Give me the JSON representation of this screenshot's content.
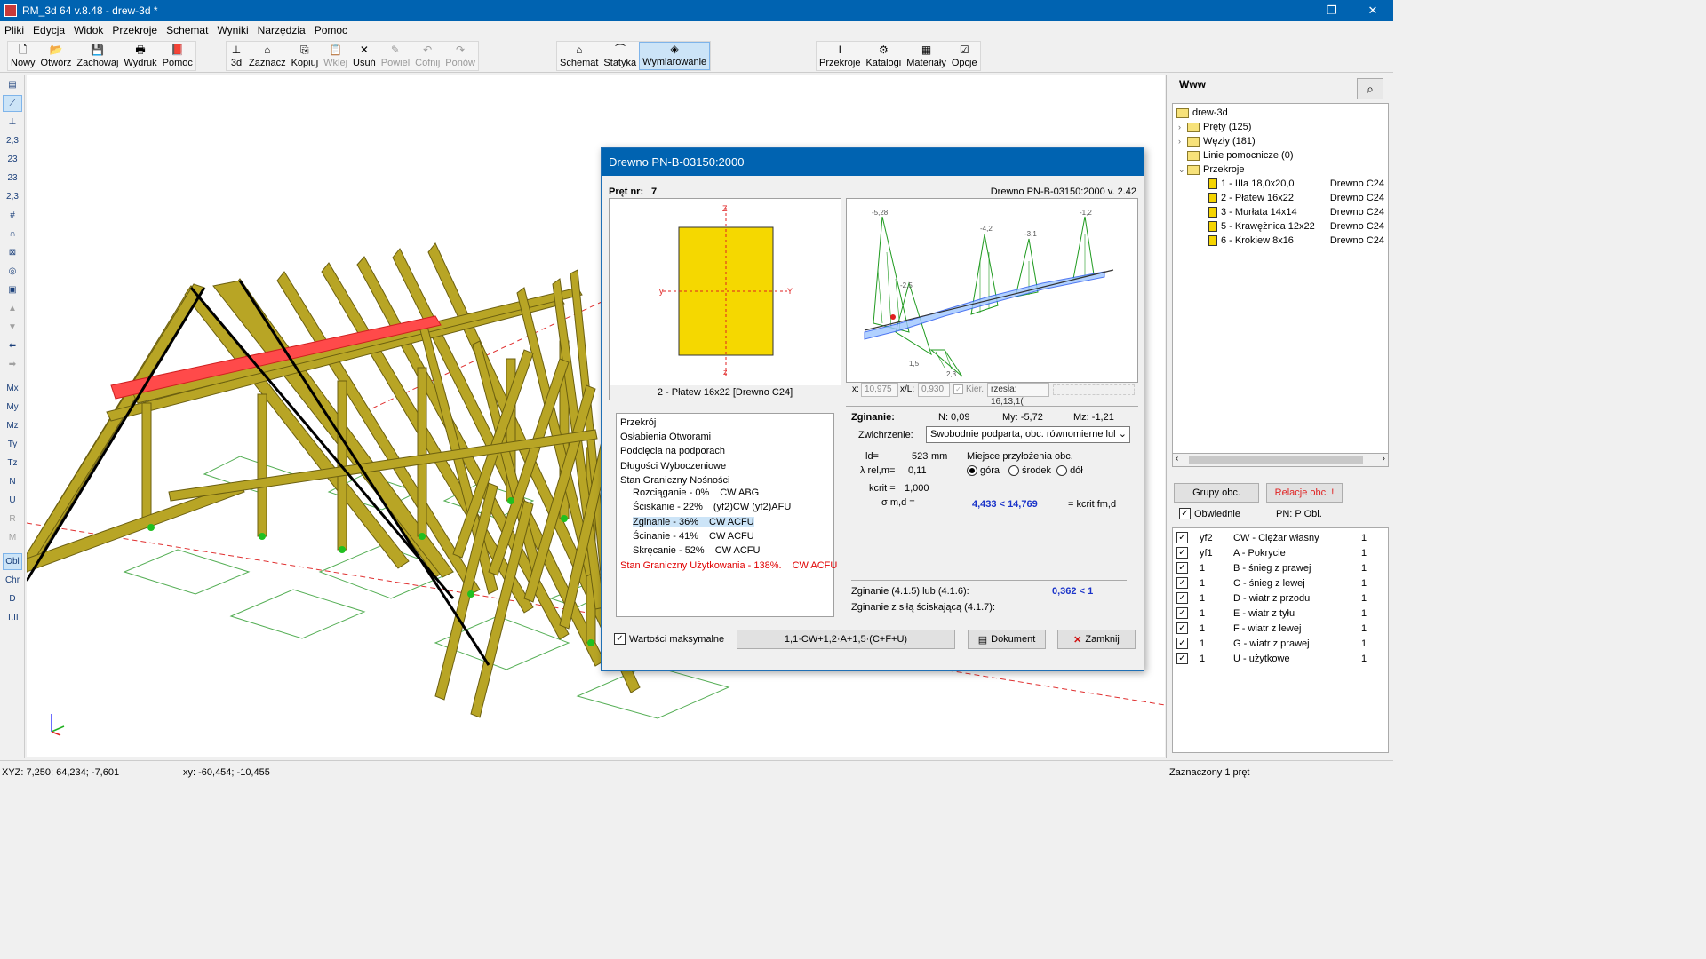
{
  "window": {
    "title": "RM_3d 64 v.8.48 - drew-3d *",
    "min": "—",
    "max": "❐",
    "close": "✕"
  },
  "menu": [
    "Pliki",
    "Edycja",
    "Widok",
    "Przekroje",
    "Schemat",
    "Wyniki",
    "Narzędzia",
    "Pomoc"
  ],
  "toolbar": {
    "file": [
      {
        "label": "Nowy",
        "icon": "new-file-icon",
        "glyph": "🗋"
      },
      {
        "label": "Otwórz",
        "icon": "open-folder-icon",
        "glyph": "📂"
      },
      {
        "label": "Zachowaj",
        "icon": "save-icon",
        "glyph": "💾"
      },
      {
        "label": "Wydruk",
        "icon": "print-icon",
        "glyph": "🖶"
      },
      {
        "label": "Pomoc",
        "icon": "help-book-icon",
        "glyph": "📕"
      }
    ],
    "edit": [
      {
        "label": "3d",
        "icon": "axes-3d-icon",
        "glyph": "⊥"
      },
      {
        "label": "Zaznacz",
        "icon": "select-icon",
        "glyph": "⌂"
      },
      {
        "label": "Kopiuj",
        "icon": "copy-icon",
        "glyph": "⎘"
      },
      {
        "label": "Wklej",
        "icon": "paste-icon",
        "glyph": "📋",
        "disabled": true
      },
      {
        "label": "Usuń",
        "icon": "delete-icon",
        "glyph": "✕"
      },
      {
        "label": "Powiel",
        "icon": "duplicate-icon",
        "glyph": "✎",
        "disabled": true
      },
      {
        "label": "Cofnij",
        "icon": "undo-icon",
        "glyph": "↶",
        "disabled": true
      },
      {
        "label": "Ponów",
        "icon": "redo-icon",
        "glyph": "↷",
        "disabled": true
      }
    ],
    "mode": [
      {
        "label": "Schemat",
        "icon": "scheme-icon",
        "glyph": "⌂"
      },
      {
        "label": "Statyka",
        "icon": "statics-icon",
        "glyph": "⏜"
      },
      {
        "label": "Wymiarowanie",
        "icon": "dimensioning-icon",
        "glyph": "◈",
        "active": true
      }
    ],
    "tools": [
      {
        "label": "Przekroje",
        "icon": "section-icon",
        "glyph": "Ι"
      },
      {
        "label": "Katalogi",
        "icon": "catalog-icon",
        "glyph": "⚙"
      },
      {
        "label": "Materiały",
        "icon": "materials-icon",
        "glyph": "▦"
      },
      {
        "label": "Opcje",
        "icon": "options-icon",
        "glyph": "☑"
      }
    ]
  },
  "left_tools": [
    {
      "name": "view-icon",
      "glyph": "▤"
    },
    {
      "name": "draw-bar-icon",
      "glyph": "⟋",
      "active": true
    },
    {
      "name": "support-icon",
      "glyph": "⊥"
    },
    {
      "name": "numbering-icon",
      "glyph": "2,3"
    },
    {
      "name": "node-number-icon",
      "glyph": "23"
    },
    {
      "name": "load-icon",
      "glyph": "23"
    },
    {
      "name": "dimension-icon",
      "glyph": "2,3"
    },
    {
      "name": "grid-icon",
      "glyph": "#"
    },
    {
      "name": "arc-icon",
      "glyph": "∩"
    },
    {
      "name": "cross-icon",
      "glyph": "⊠"
    },
    {
      "name": "target-icon",
      "glyph": "◎"
    },
    {
      "name": "camera-icon",
      "glyph": "▣"
    },
    {
      "name": "arrow-up-icon",
      "glyph": "▲",
      "gray": true
    },
    {
      "name": "arrow-down-icon",
      "glyph": "▼",
      "gray": true
    },
    {
      "name": "arrow-left-icon",
      "glyph": "⬅"
    },
    {
      "name": "arrow-right-icon",
      "glyph": "➡",
      "gray": true
    },
    {
      "name": "mx-button",
      "glyph": "Mx"
    },
    {
      "name": "my-button",
      "glyph": "My"
    },
    {
      "name": "mz-button",
      "glyph": "Mz"
    },
    {
      "name": "ty-button",
      "glyph": "Ty"
    },
    {
      "name": "tz-button",
      "glyph": "Tz"
    },
    {
      "name": "n-button",
      "glyph": "N"
    },
    {
      "name": "u-button",
      "glyph": "U"
    },
    {
      "name": "r-button",
      "glyph": "R",
      "gray": true
    },
    {
      "name": "m-button",
      "glyph": "M",
      "gray": true
    },
    {
      "name": "obl-button",
      "glyph": "Obl",
      "active": true
    },
    {
      "name": "chr-button",
      "glyph": "Chr"
    },
    {
      "name": "d-button",
      "glyph": "D"
    },
    {
      "name": "t-button",
      "glyph": "T.II"
    }
  ],
  "right_panel": {
    "title": "Www",
    "tree": {
      "root": "drew-3d",
      "items": [
        {
          "label": "Pręty (125)"
        },
        {
          "label": "Węzły (181)"
        },
        {
          "label": "Linie pomocnicze (0)"
        },
        {
          "label": "Przekroje"
        }
      ],
      "sections": [
        {
          "label": "1 - IIIa 18,0x20,0",
          "material": "Drewno C24"
        },
        {
          "label": "2 - Płatew 16x22",
          "material": "Drewno C24"
        },
        {
          "label": "3 - Murłata 14x14",
          "material": "Drewno C24"
        },
        {
          "label": "5 - Krawężnica 12x22",
          "material": "Drewno C24"
        },
        {
          "label": "6 - Krokiew 8x16",
          "material": "Drewno C24"
        }
      ]
    },
    "btn_groups": "Grupy obc.",
    "btn_relations": "Relacje obc. !",
    "chk_label": "Obwiednie",
    "pn_label": "PN:  P Obl.",
    "loads": [
      {
        "code": "yf2",
        "name": "CW - Ciężar własny",
        "val": "1"
      },
      {
        "code": "yf1",
        "name": "A - Pokrycie",
        "val": "1"
      },
      {
        "code": "1",
        "name": "B - śnieg z prawej",
        "val": "1"
      },
      {
        "code": "1",
        "name": "C - śnieg z lewej",
        "val": "1"
      },
      {
        "code": "1",
        "name": "D - wiatr z przodu",
        "val": "1"
      },
      {
        "code": "1",
        "name": "E - wiatr z tyłu",
        "val": "1"
      },
      {
        "code": "1",
        "name": "F - wiatr z lewej",
        "val": "1"
      },
      {
        "code": "1",
        "name": "G - wiatr z prawej",
        "val": "1"
      },
      {
        "code": "1",
        "name": "U - użytkowe",
        "val": "1"
      }
    ]
  },
  "status": {
    "xyz": "XYZ: 7,250; 64,234; -7,601",
    "xy": "xy: -60,454; -10,455",
    "right": "Zaznaczony 1 pręt"
  },
  "dialog": {
    "title": "Drewno PN-B-03150:2000",
    "bar_label": "Pręt nr:",
    "bar_no": "7",
    "norm": "Drewno PN-B-03150:2000 v. 2.42",
    "section_caption": "2 - Płatew 16x22  [Drewno C24]",
    "axis_z": "Z",
    "axis_y": "Y",
    "axis_z_small": "z",
    "axis_y_small": "y",
    "x_label": "x:",
    "x_val": "10,975",
    "xl_label": "x/L:",
    "xl_val": "0,930",
    "kier_label": "Kier.",
    "kier_val": "rzesła: 16,13,1(",
    "checks": {
      "header": "Przekrój",
      "items": [
        "Osłabienia Otworami",
        "Podcięcia na podporach",
        "Długości Wyboczeniowe",
        "Stan Graniczny Nośności"
      ],
      "sub": [
        {
          "label": "Rozciąganie - 0%",
          "comb": "CW ABG"
        },
        {
          "label": "Ściskanie - 22%",
          "comb": "(yf2)CW (yf2)AFU"
        },
        {
          "label": "Zginanie - 36%",
          "comb": "CW ACFU",
          "selected": true
        },
        {
          "label": "Ścinanie - 41%",
          "comb": "CW ACFU"
        },
        {
          "label": "Skręcanie - 52%",
          "comb": "CW ACFU"
        }
      ],
      "sgu": "Stan Graniczny Użytkowania - 138%.",
      "sgu_comb": "CW ACFU"
    },
    "bending": {
      "title": "Zginanie:",
      "n": "N: 0,09",
      "my": "My: -5,72",
      "mz": "Mz: -1,21",
      "zwich_label": "Zwichrzenie:",
      "zwich_value": "Swobodnie podparta, obc. równomierne lul",
      "ld_label": "ld=",
      "ld_val": "523",
      "ld_unit": "mm",
      "lrel_label": "λ rel,m=",
      "lrel_val": "0,11",
      "kcrit_label": "kcrit =",
      "kcrit_val": "1,000",
      "sigma_label": "σ m,d =",
      "sigma_val": "4,433 < 14,769",
      "kcrit_f": "= kcrit fm,d",
      "place_title": "Miejsce przyłożenia obc.",
      "radio_top": "góra",
      "radio_mid": "środek",
      "radio_bot": "dół",
      "check1_label": "Zginanie (4.1.5) lub (4.1.6):",
      "check1_val": "0,362 < 1",
      "check2_label": "Zginanie z siłą ściskającą (4.1.7):"
    },
    "max_values": "Wartości maksymalne",
    "combination": "1,1·CW+1,2·A+1,5·(C+F+U)",
    "btn_doc": "Dokument",
    "btn_close": "Zamknij",
    "diagram_labels": [
      "-5,28",
      "-4,2",
      "-3,1",
      "-1,2",
      "-2,5",
      "1,5",
      "2,3"
    ]
  },
  "colors": {
    "accent": "#0063b1",
    "timber": "#b5a41f",
    "highlight": "#ff4040",
    "section_fill": "#f5d800"
  }
}
